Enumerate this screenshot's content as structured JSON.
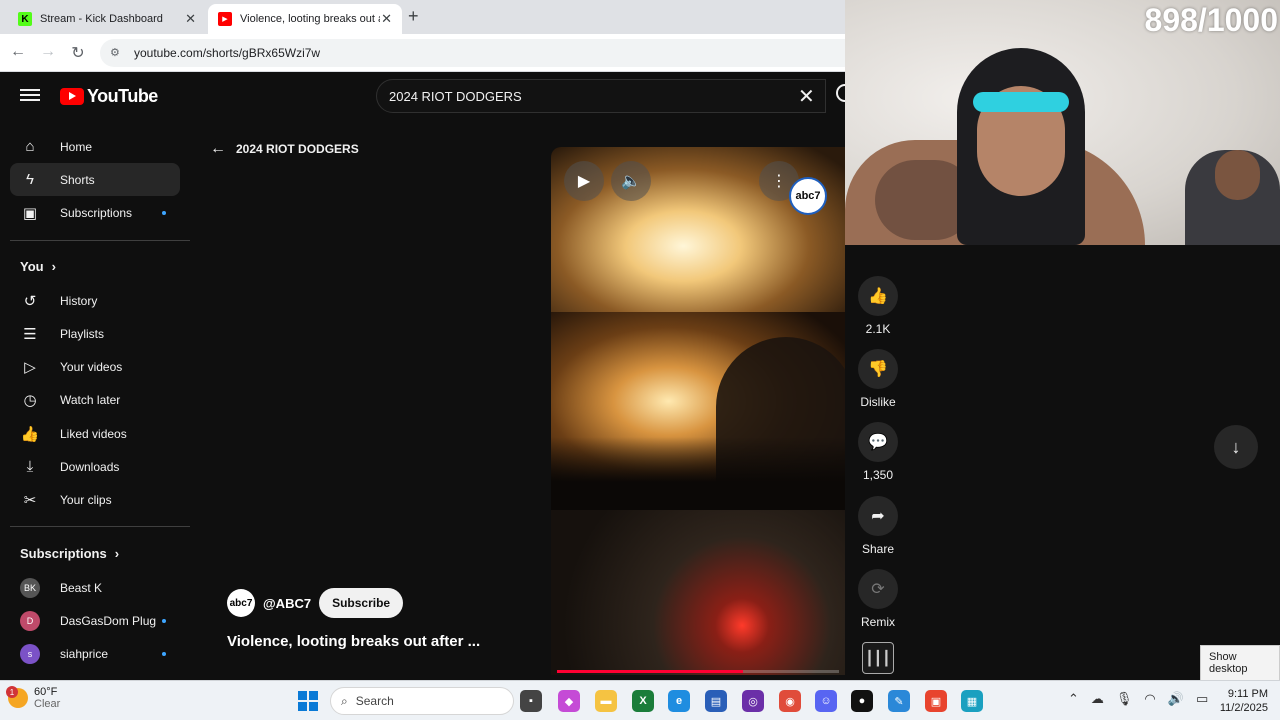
{
  "browser": {
    "tabs": [
      {
        "title": "Stream - Kick Dashboard",
        "favicon": "K"
      },
      {
        "title": "Violence, looting breaks out aft",
        "favicon": "▶"
      }
    ],
    "url": "youtube.com/shorts/gBRx65Wzi7w"
  },
  "youtube": {
    "logo_text": "YouTube",
    "search_query": "2024 RIOT DODGERS",
    "back_label": "2024 RIOT DODGERS",
    "sidebar": {
      "main": [
        {
          "label": "Home",
          "icon": "⌂"
        },
        {
          "label": "Shorts",
          "icon": "ϟ"
        },
        {
          "label": "Subscriptions",
          "icon": "▣"
        }
      ],
      "you_header": "You",
      "you": [
        {
          "label": "History",
          "icon": "↺"
        },
        {
          "label": "Playlists",
          "icon": "☰"
        },
        {
          "label": "Your videos",
          "icon": "▷"
        },
        {
          "label": "Watch later",
          "icon": "◷"
        },
        {
          "label": "Liked videos",
          "icon": "👍"
        },
        {
          "label": "Downloads",
          "icon": "⤓"
        },
        {
          "label": "Your clips",
          "icon": "✂"
        }
      ],
      "subs_header": "Subscriptions",
      "subscriptions": [
        {
          "label": "Beast K",
          "avatar": "BK",
          "color": "#555555"
        },
        {
          "label": "DasGasDom Plug",
          "avatar": "D",
          "color": "#c04a6a"
        },
        {
          "label": "siahprice",
          "avatar": "s",
          "color": "#7b52c7"
        }
      ]
    },
    "video": {
      "watermark": "abc7",
      "progress": 0.66,
      "channel_handle": "@ABC7",
      "channel_avatar": "abc7",
      "subscribe_label": "Subscribe",
      "title": "Violence, looting breaks out after ..."
    },
    "actions": [
      {
        "label": "2.1K",
        "icon": "👍"
      },
      {
        "label": "Dislike",
        "icon": "👎"
      },
      {
        "label": "1,350",
        "icon": "💬"
      },
      {
        "label": "Share",
        "icon": "➦"
      },
      {
        "label": "Remix",
        "icon": "⟳"
      }
    ]
  },
  "overlay": {
    "counter": "898/1000",
    "show_desktop": "Show desktop"
  },
  "taskbar": {
    "weather_temp": "60°F",
    "weather_desc": "Clear",
    "weather_badge": "1",
    "search_label": "Search",
    "time": "9:11 PM",
    "date": "11/2/2025"
  },
  "colors": {
    "yt_red": "#ff0000",
    "accent_blue": "#3ea6ff",
    "bg": "#0f0f0f"
  }
}
